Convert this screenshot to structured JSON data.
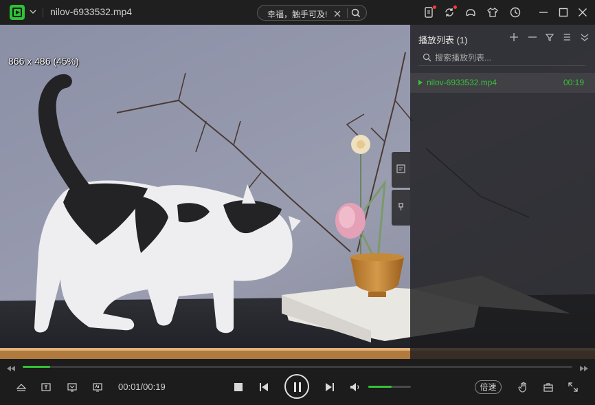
{
  "titlebar": {
    "file_title": "nilov-6933532.mp4",
    "search_pill_text": "幸福，触手可及!",
    "icons": [
      "app-logo",
      "chevron-down-icon",
      "phone-icon",
      "refresh-icon",
      "gamepad-icon",
      "tshirt-icon",
      "clock-icon",
      "minimize-icon",
      "maximize-icon",
      "close-icon"
    ],
    "notification_color": "#ff3b3b"
  },
  "video": {
    "resolution_label": "866 x 486 (45%)"
  },
  "playlist": {
    "title": "播放列表 (1)",
    "search_placeholder": "搜索播放列表...",
    "items": [
      {
        "name": "nilov-6933532.mp4",
        "duration": "00:19",
        "playing": true
      }
    ],
    "accent_color": "#3ac13a"
  },
  "controls": {
    "current_time": "00:01/00:19",
    "progress_fraction": 0.05,
    "volume_fraction": 0.55,
    "speed_label": "倍速",
    "accent_color": "#36c136"
  }
}
